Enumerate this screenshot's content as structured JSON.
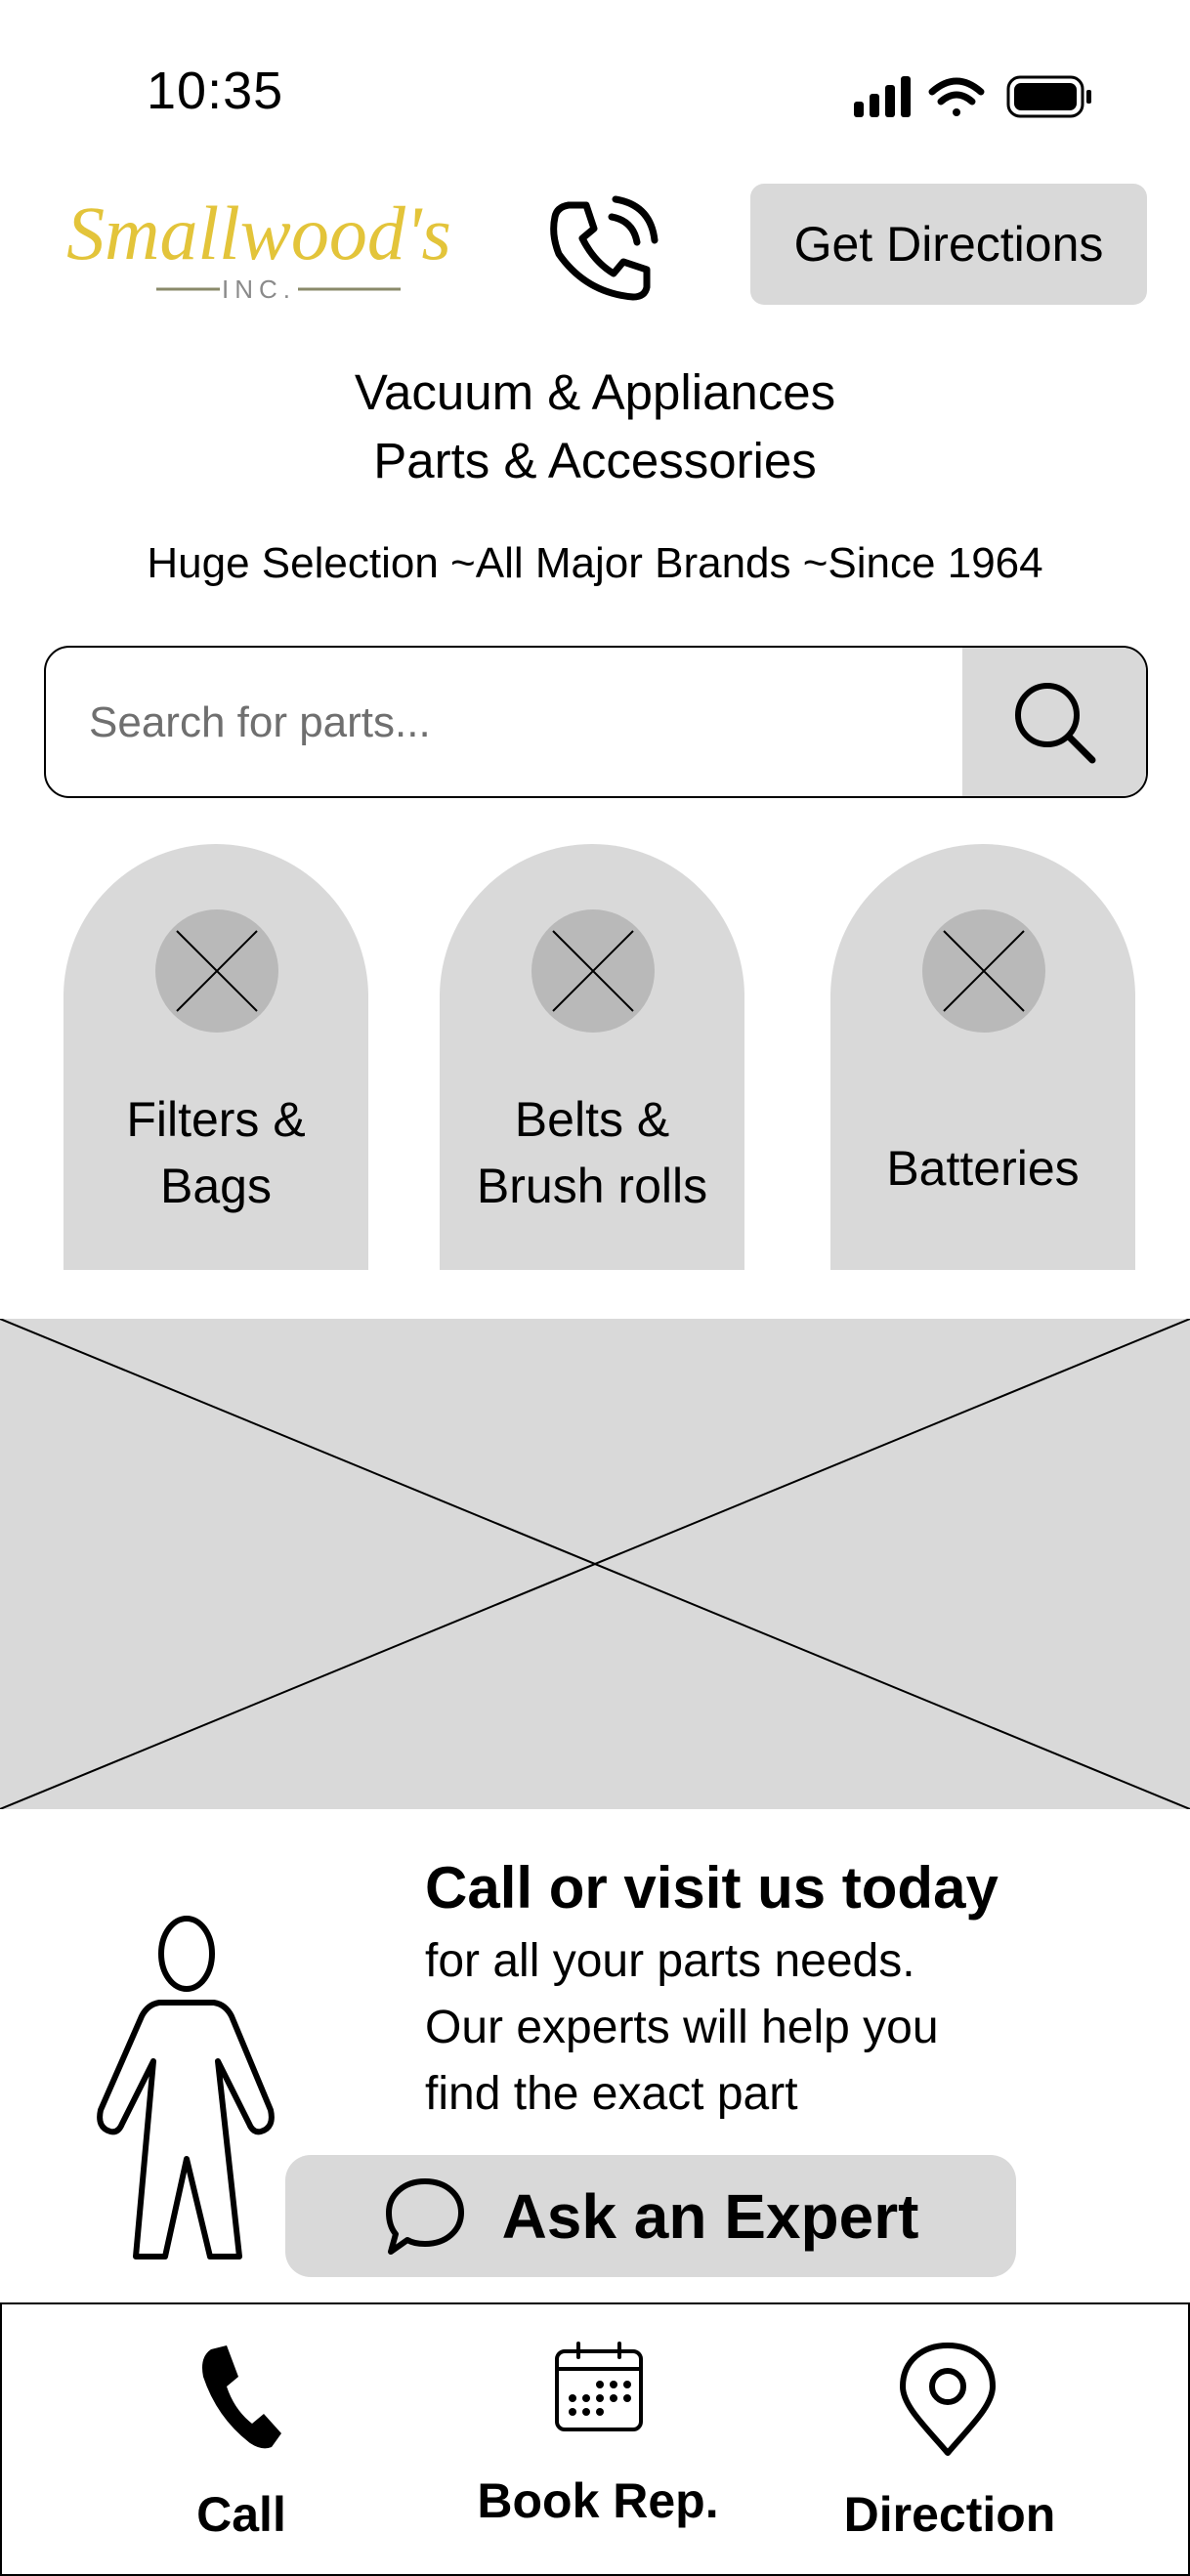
{
  "status_bar": {
    "time": "10:35",
    "icons": [
      "signal-icon",
      "wifi-icon",
      "battery-icon"
    ]
  },
  "header": {
    "logo_text": "Smallwood's",
    "logo_subtext": "INC.",
    "phone_icon": "phone-ringing-icon",
    "directions_label": "Get Directions"
  },
  "taglines": {
    "line1": "Vacuum & Appliances",
    "line2": "Parts & Accessories",
    "line3": "Huge Selection ~All Major Brands ~Since 1964"
  },
  "search": {
    "placeholder": "Search for parts...",
    "value": "",
    "icon": "search-icon"
  },
  "categories": [
    {
      "label_line1": "Filters &",
      "label_line2": "Bags",
      "icon": "image-placeholder-icon"
    },
    {
      "label_line1": "Belts &",
      "label_line2": "Brush rolls",
      "icon": "image-placeholder-icon"
    },
    {
      "label_line1": "Batteries",
      "label_line2": "",
      "icon": "image-placeholder-icon"
    }
  ],
  "banner": {
    "icon": "image-placeholder-icon"
  },
  "experts": {
    "heading": "Call or visit us today",
    "line1": "for all your parts needs.",
    "line2": "Our experts will help you",
    "line3": "find the exact part",
    "button_label": "Ask an Expert",
    "button_icon": "chat-bubble-icon",
    "illustration_icon": "person-icon"
  },
  "bottom_nav": [
    {
      "label": "Call",
      "icon": "phone-icon"
    },
    {
      "label": "Book Rep.",
      "icon": "calendar-icon"
    },
    {
      "label": "Direction",
      "icon": "map-pin-icon"
    }
  ],
  "colors": {
    "placeholder_gray": "#d9d9d9",
    "logo_gold": "#e3c43a",
    "text": "#000000"
  }
}
